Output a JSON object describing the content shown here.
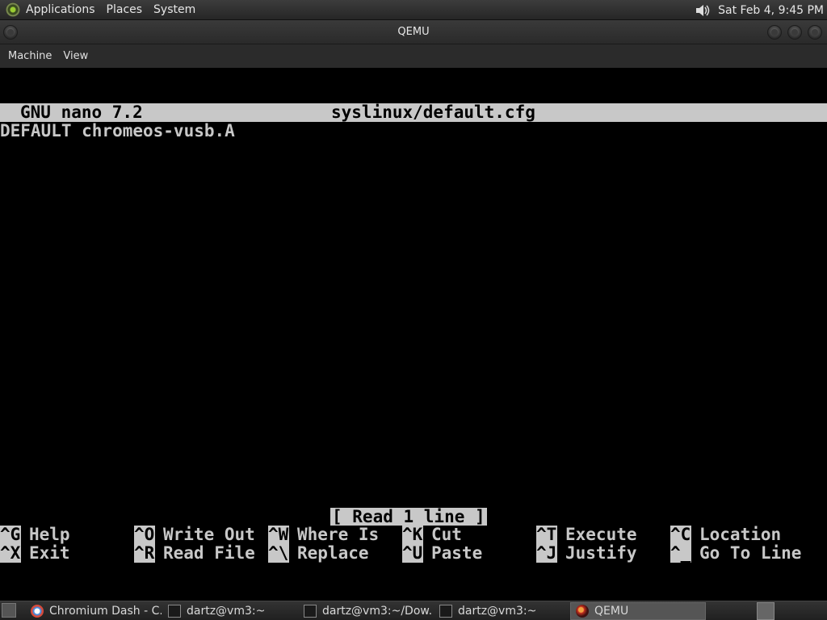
{
  "top_panel": {
    "menus": [
      "Applications",
      "Places",
      "System"
    ],
    "clock": "Sat Feb  4,  9:45 PM"
  },
  "window": {
    "title": "QEMU"
  },
  "menubar": {
    "items": [
      "Machine",
      "View"
    ]
  },
  "nano": {
    "version": "GNU nano 7.2",
    "filename": "syslinux/default.cfg",
    "content_line": "DEFAULT chromeos-vusb.A",
    "status": "[ Read 1 line ]",
    "shortcuts": [
      {
        "key": "^G",
        "label": "Help"
      },
      {
        "key": "^X",
        "label": "Exit"
      },
      {
        "key": "^O",
        "label": "Write Out"
      },
      {
        "key": "^R",
        "label": "Read File"
      },
      {
        "key": "^W",
        "label": "Where Is"
      },
      {
        "key": "^\\",
        "label": "Replace"
      },
      {
        "key": "^K",
        "label": "Cut"
      },
      {
        "key": "^U",
        "label": "Paste"
      },
      {
        "key": "^T",
        "label": "Execute"
      },
      {
        "key": "^J",
        "label": "Justify"
      },
      {
        "key": "^C",
        "label": "Location"
      },
      {
        "key": "^_",
        "label": "Go To Line"
      }
    ]
  },
  "taskbar": {
    "tasks": [
      {
        "label": "Chromium Dash - C...",
        "icon": "chromium-icon"
      },
      {
        "label": "dartz@vm3:~",
        "icon": "terminal-icon"
      },
      {
        "label": "dartz@vm3:~/Dow...",
        "icon": "terminal-icon"
      },
      {
        "label": "dartz@vm3:~",
        "icon": "terminal-icon"
      },
      {
        "label": "QEMU",
        "icon": "qemu-icon"
      }
    ]
  }
}
